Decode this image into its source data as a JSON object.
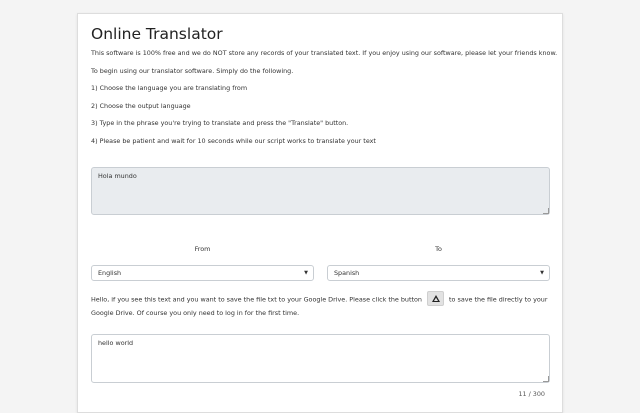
{
  "page": {
    "title": "Online Translator",
    "intro": "This software is 100% free and we do NOT store any records of your translated text. If you enjoy using our software, please let your friends know.",
    "begin": "To begin using our translator software. Simply do the following.",
    "steps": [
      "1) Choose the language you are translating from",
      "2) Choose the output language",
      "3) Type in the phrase you're trying to translate and press the \"Translate\" button.",
      "4) Please be patient and wait for 10 seconds while our script works to translate your text"
    ]
  },
  "input": {
    "value": "Hola mundo"
  },
  "languages": {
    "from_label": "From",
    "to_label": "To",
    "from_selected": "English",
    "to_selected": "Spanish"
  },
  "drive": {
    "text_before": "Hello, if you see this text and you want to save the file txt to your Google Drive. Please click the button",
    "text_after": "to save the file directly to your Google Drive. Of course you only need to log in for the first time.",
    "button_icon": "google-drive-icon"
  },
  "output": {
    "value": "hello world",
    "counter": "11 / 300"
  }
}
